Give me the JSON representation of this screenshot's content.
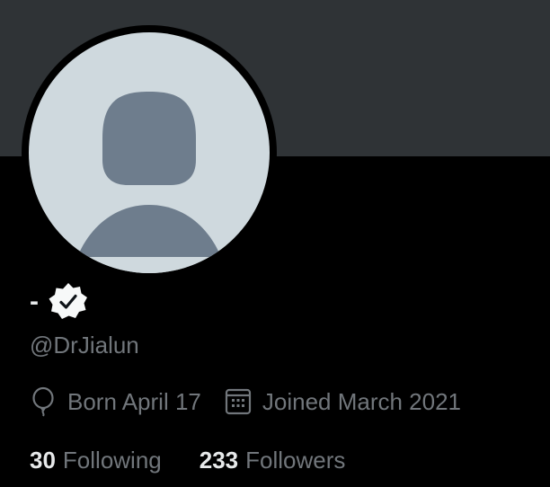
{
  "profile": {
    "display_name": "-",
    "handle": "@DrJialun",
    "birthday": "Born April 17",
    "joined": "Joined March 2021",
    "verified": true
  },
  "stats": {
    "following_count": "30",
    "following_label": "Following",
    "followers_count": "233",
    "followers_label": "Followers"
  },
  "icons": {
    "verified": "verified-badge-icon",
    "birthday": "balloon-icon",
    "joined": "calendar-icon"
  },
  "colors": {
    "background": "#000000",
    "banner": "#2f3336",
    "avatar_bg": "#cfd9de",
    "avatar_figure": "#6e7d8d",
    "text_primary": "#e7e9ea",
    "text_secondary": "#71767b",
    "verified_badge": "#f7f9f9"
  }
}
